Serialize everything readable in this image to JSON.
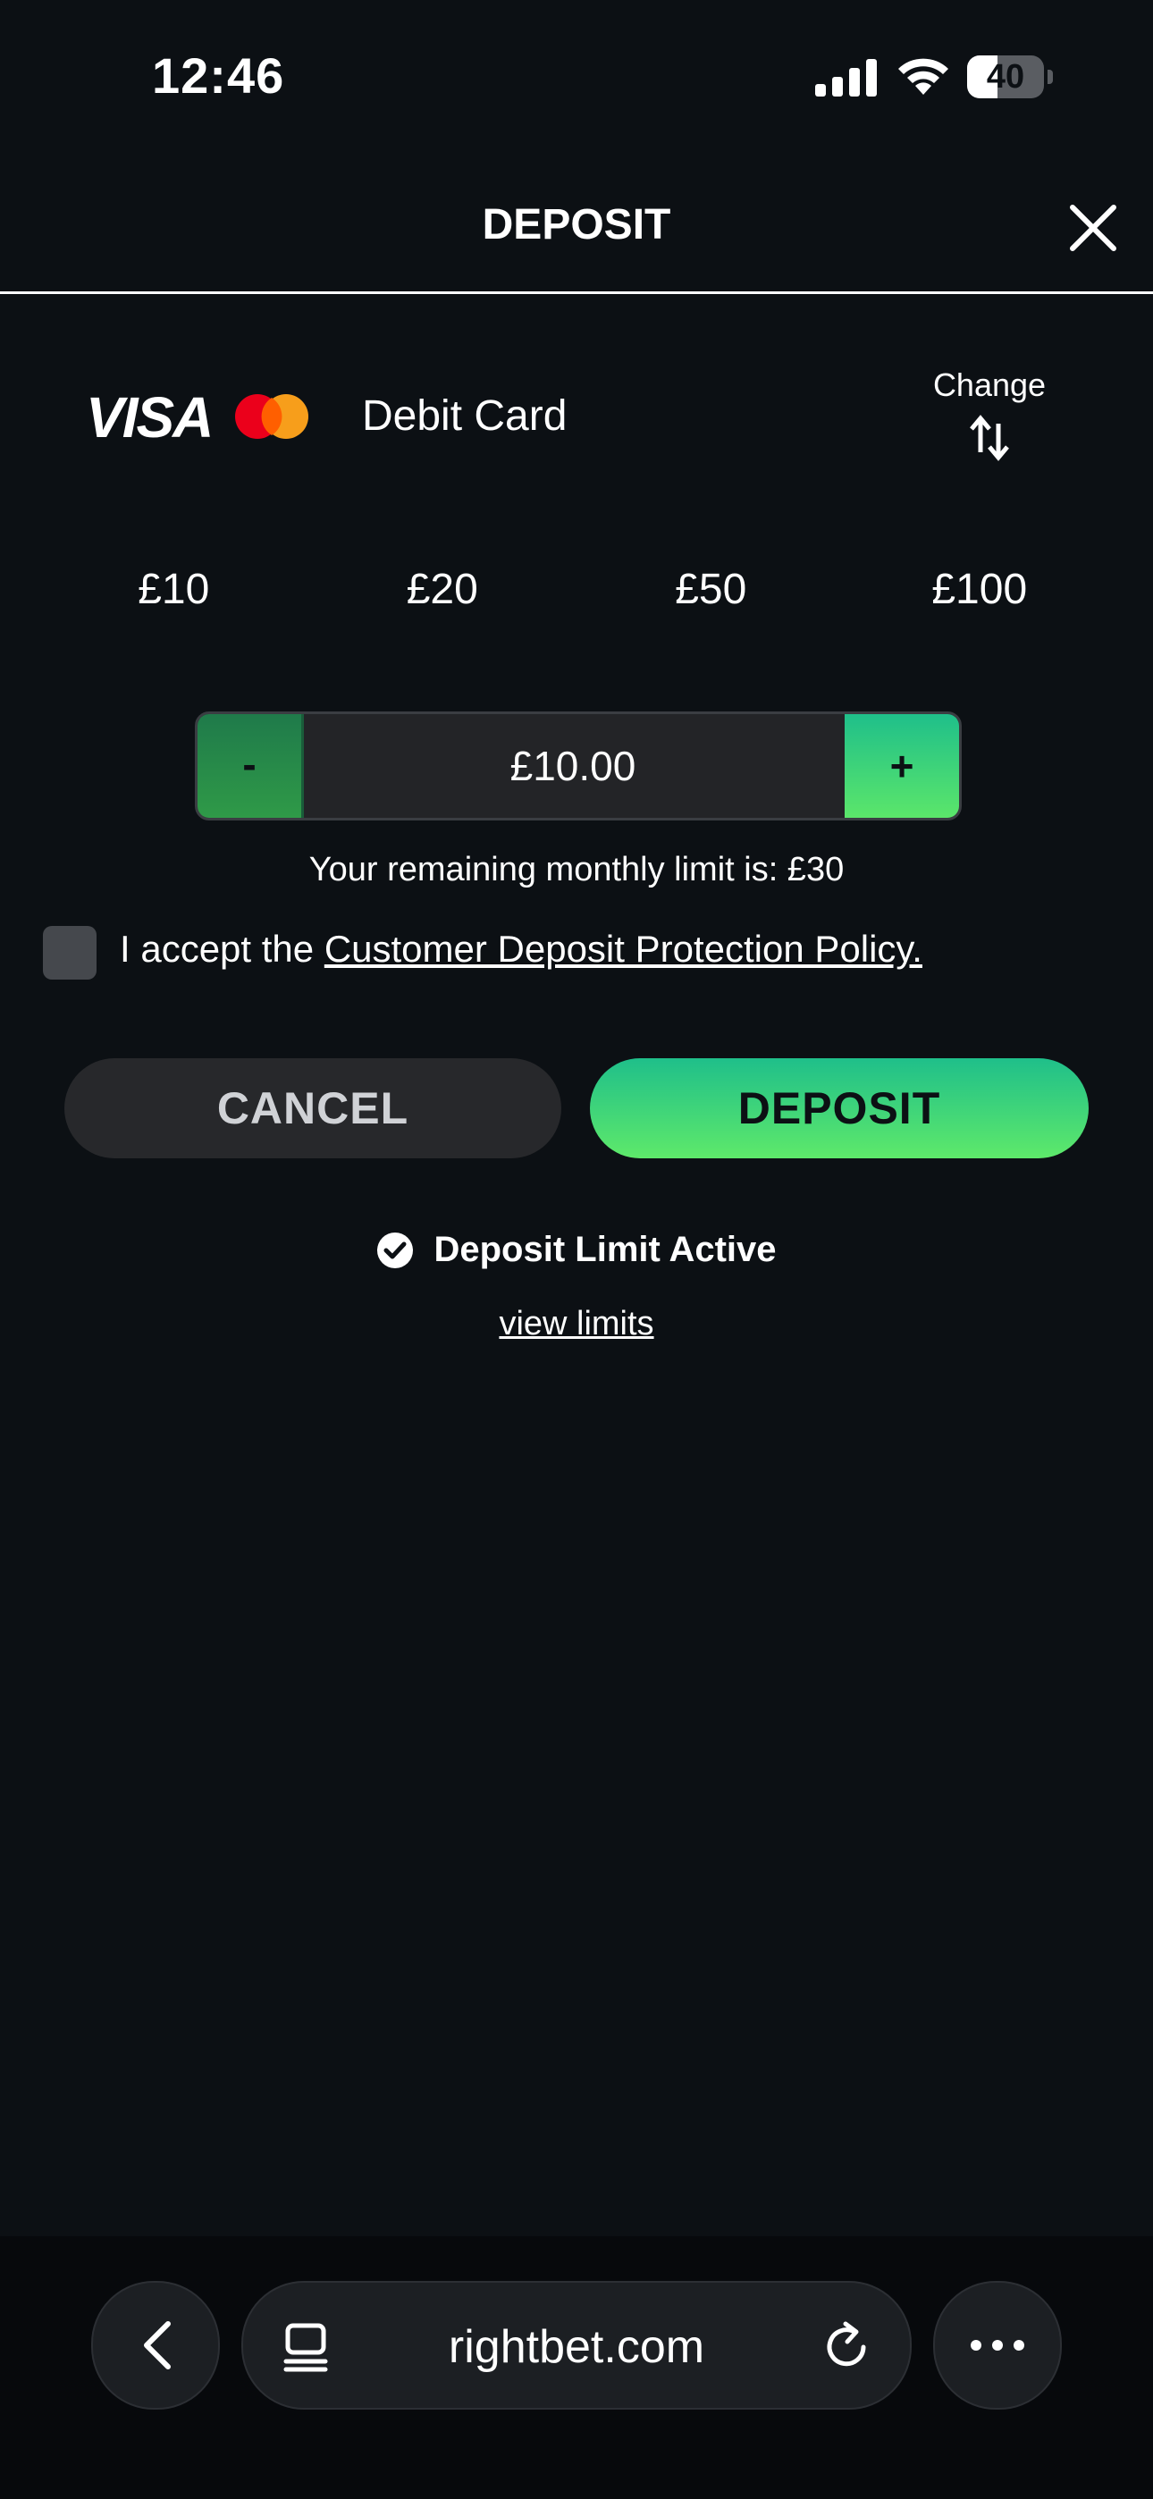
{
  "status_bar": {
    "time": "12:46",
    "battery_level": "40",
    "battery_fraction": 0.4,
    "icons": [
      "signal-icon",
      "wifi-icon",
      "battery-icon"
    ]
  },
  "header": {
    "title": "DEPOSIT",
    "close_icon": "close-icon"
  },
  "payment_method": {
    "brand": "VISA",
    "secondary_brand_icon": "mastercard-icon",
    "label": "Debit Card",
    "change_label": "Change",
    "change_icon": "swap-arrows-icon"
  },
  "quick_amounts": [
    "£10",
    "£20",
    "£50",
    "£100"
  ],
  "stepper": {
    "minus_label": "-",
    "plus_label": "+",
    "value": "£10.00"
  },
  "limit_text": "Your remaining monthly limit is: £30",
  "policy": {
    "prefix": "I accept the ",
    "link_text": "Customer Deposit Protection Policy.",
    "checked": false
  },
  "buttons": {
    "cancel_label": "CANCEL",
    "deposit_label": "DEPOSIT"
  },
  "deposit_limit": {
    "status_text": "Deposit Limit Active",
    "icon": "check-circle-icon",
    "view_link": "view limits"
  },
  "browser": {
    "url": "rightbet.com",
    "icons": [
      "back-icon",
      "tab-icon",
      "reload-icon",
      "more-icon"
    ]
  },
  "colors": {
    "background": "#0c1014",
    "accent_green_top": "#1fbf8a",
    "accent_green_bottom": "#5ee96a",
    "cancel_bg": "#27282b",
    "mastercard_red": "#eb001b",
    "mastercard_orange": "#f79e1b"
  }
}
